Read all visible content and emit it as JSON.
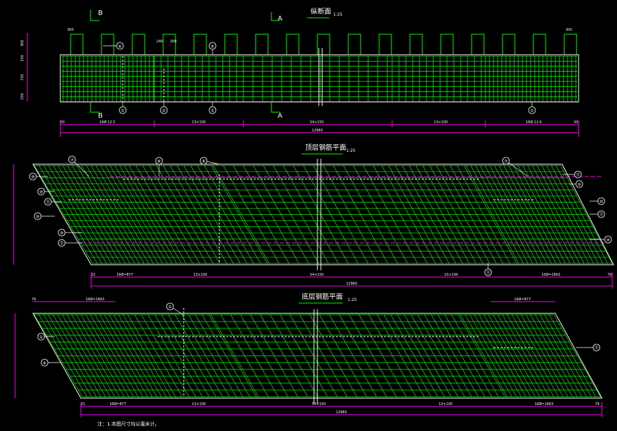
{
  "colors": {
    "background": "#000000",
    "rebar": "#00FF00",
    "outline": "#FFFFFF",
    "dimension": "#FF00FF",
    "section_text": "#FFFFFF",
    "centerline": "#FF00FF"
  },
  "views": {
    "elevation": {
      "title": "纵断面",
      "scale": "1:25"
    },
    "top": {
      "title": "顶层钢筋平面",
      "scale": "1:25"
    },
    "bottom": {
      "title": "底层钢筋平面",
      "scale": "1:25"
    }
  },
  "section_marks": {
    "a_top": "A",
    "a_bottom": "A",
    "b_top": "B",
    "b_bottom": "B"
  },
  "elevation_dims": {
    "left_end": "50",
    "seg1": "16Ø-12.5",
    "seg2": "13×100",
    "center": "54×150",
    "seg3": "13×100",
    "seg4": "16Ø-12.6",
    "right_end": "50",
    "total": "12960",
    "top_left": "300",
    "top_right": "300",
    "mid_a": "240",
    "mid_b": "200",
    "left_v1": "300",
    "left_v2": "150",
    "left_v3": "720",
    "left_v4": "150"
  },
  "top_dims": {
    "left_end": "21",
    "seg1": "16Ø=877",
    "seg2": "13×100",
    "center": "54×150",
    "seg3": "15×100",
    "seg4": "16Ø=1663",
    "right_end": "79",
    "total": "12960"
  },
  "bottom_dims": {
    "left_end": "21",
    "seg1": "16Ø=877",
    "seg2": "13×100",
    "center": "54×150",
    "seg3": "13×100",
    "seg4": "16Ø=1663",
    "right_end": "79",
    "total": "12960",
    "top_left_small": "79",
    "top_left_label": "16Ø=1663",
    "top_right_label": "16Ø=877"
  },
  "callouts": {
    "elev": [
      "⑥",
      "①",
      "②",
      "①",
      "⑥",
      "①"
    ],
    "top": [
      "⑦",
      "⑧",
      "⑨",
      "⑦",
      "⑩",
      "⑪"
    ],
    "bottom": [
      "①",
      "①",
      "⑥",
      "⑪"
    ]
  },
  "note": "注：1.本图尺寸均以毫米计。"
}
